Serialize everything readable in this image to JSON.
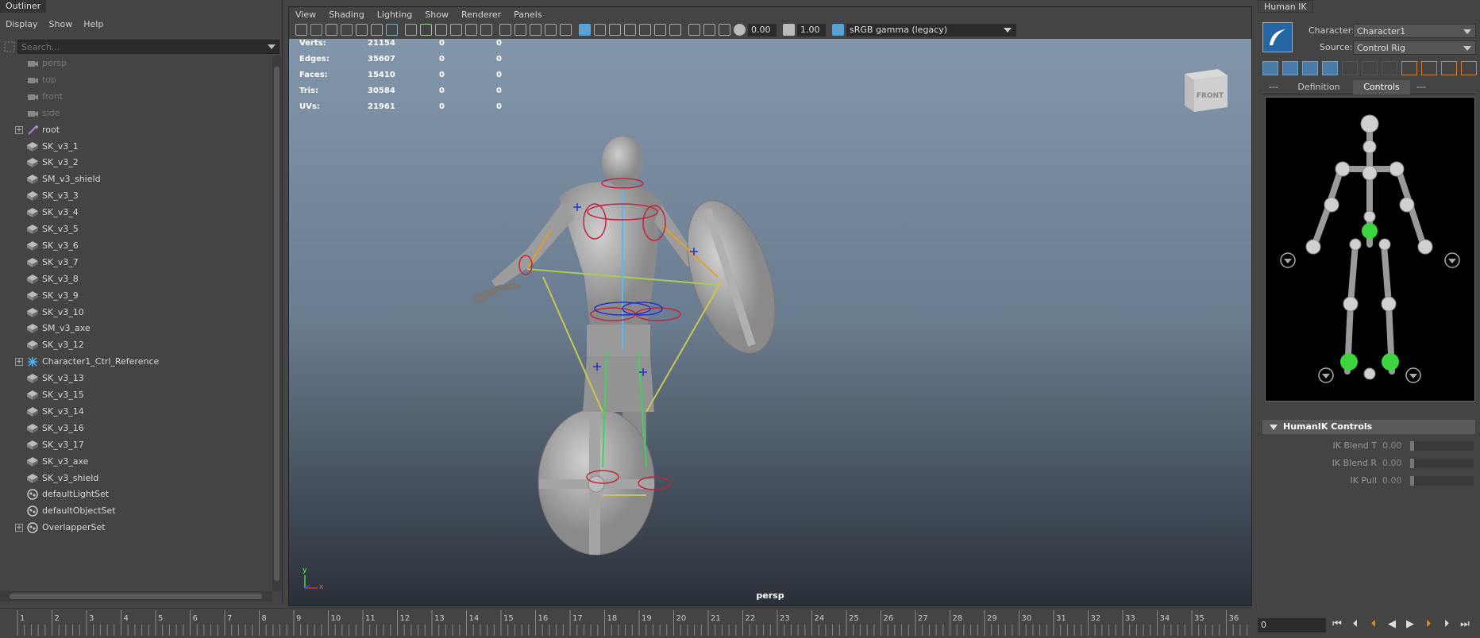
{
  "outliner": {
    "title": "Outliner",
    "menus": [
      "Display",
      "Show",
      "Help"
    ],
    "search_placeholder": "Search...",
    "items": [
      {
        "label": "persp",
        "type": "camera",
        "dim": true,
        "expand": false
      },
      {
        "label": "top",
        "type": "camera",
        "dim": true,
        "expand": false
      },
      {
        "label": "front",
        "type": "camera",
        "dim": true,
        "expand": false
      },
      {
        "label": "side",
        "type": "camera",
        "dim": true,
        "expand": false
      },
      {
        "label": "root",
        "type": "joint",
        "dim": false,
        "expand": true
      },
      {
        "label": "SK_v3_1",
        "type": "mesh",
        "dim": false,
        "expand": false
      },
      {
        "label": "SK_v3_2",
        "type": "mesh",
        "dim": false,
        "expand": false
      },
      {
        "label": "SM_v3_shield",
        "type": "mesh",
        "dim": false,
        "expand": false
      },
      {
        "label": "SK_v3_3",
        "type": "mesh",
        "dim": false,
        "expand": false
      },
      {
        "label": "SK_v3_4",
        "type": "mesh",
        "dim": false,
        "expand": false
      },
      {
        "label": "SK_v3_5",
        "type": "mesh",
        "dim": false,
        "expand": false
      },
      {
        "label": "SK_v3_6",
        "type": "mesh",
        "dim": false,
        "expand": false
      },
      {
        "label": "SK_v3_7",
        "type": "mesh",
        "dim": false,
        "expand": false
      },
      {
        "label": "SK_v3_8",
        "type": "mesh",
        "dim": false,
        "expand": false
      },
      {
        "label": "SK_v3_9",
        "type": "mesh",
        "dim": false,
        "expand": false
      },
      {
        "label": "SK_v3_10",
        "type": "mesh",
        "dim": false,
        "expand": false
      },
      {
        "label": "SM_v3_axe",
        "type": "mesh",
        "dim": false,
        "expand": false
      },
      {
        "label": "SK_v3_12",
        "type": "mesh",
        "dim": false,
        "expand": false
      },
      {
        "label": "Character1_Ctrl_Reference",
        "type": "ctrl",
        "dim": false,
        "expand": true
      },
      {
        "label": "SK_v3_13",
        "type": "mesh",
        "dim": false,
        "expand": false
      },
      {
        "label": "SK_v3_15",
        "type": "mesh",
        "dim": false,
        "expand": false
      },
      {
        "label": "SK_v3_14",
        "type": "mesh",
        "dim": false,
        "expand": false
      },
      {
        "label": "SK_v3_16",
        "type": "mesh",
        "dim": false,
        "expand": false
      },
      {
        "label": "SK_v3_17",
        "type": "mesh",
        "dim": false,
        "expand": false
      },
      {
        "label": "SK_v3_axe",
        "type": "mesh",
        "dim": false,
        "expand": false
      },
      {
        "label": "SK_v3_shield",
        "type": "mesh",
        "dim": false,
        "expand": false
      },
      {
        "label": "defaultLightSet",
        "type": "set",
        "dim": false,
        "expand": false
      },
      {
        "label": "defaultObjectSet",
        "type": "set",
        "dim": false,
        "expand": false
      },
      {
        "label": "OverlapperSet",
        "type": "set",
        "dim": false,
        "expand": true
      }
    ]
  },
  "viewport": {
    "menus": [
      "View",
      "Shading",
      "Lighting",
      "Show",
      "Renderer",
      "Panels"
    ],
    "exposure": "0.00",
    "gamma": "1.00",
    "color_space": "sRGB gamma (legacy)",
    "camera": "persp",
    "viewcube_label": "FRONT",
    "hud": [
      {
        "label": "Verts:",
        "v1": "21154",
        "v2": "0",
        "v3": "0"
      },
      {
        "label": "Edges:",
        "v1": "35607",
        "v2": "0",
        "v3": "0"
      },
      {
        "label": "Faces:",
        "v1": "15410",
        "v2": "0",
        "v3": "0"
      },
      {
        "label": "Tris:",
        "v1": "30584",
        "v2": "0",
        "v3": "0"
      },
      {
        "label": "UVs:",
        "v1": "21961",
        "v2": "0",
        "v3": "0"
      }
    ],
    "axis_y": "y",
    "axis_x": "x"
  },
  "human_ik": {
    "title": "Human IK",
    "character_label": "Character:",
    "character_value": "Character1",
    "source_label": "Source:",
    "source_value": "Control Rig",
    "tabs": [
      "---",
      "Definition",
      "Controls",
      "---"
    ],
    "active_tab": "Controls",
    "controls_header": "HumanIK Controls",
    "ik_rows": [
      {
        "label": "IK Blend T",
        "value": "0.00"
      },
      {
        "label": "IK Blend R",
        "value": "0.00"
      },
      {
        "label": "IK Pull",
        "value": "0.00"
      }
    ]
  },
  "timeline": {
    "ticks": [
      "1",
      "2",
      "3",
      "4",
      "5",
      "6",
      "7",
      "8",
      "9",
      "10",
      "11",
      "12",
      "13",
      "14",
      "15",
      "16",
      "17",
      "18",
      "19",
      "20",
      "21",
      "22",
      "23",
      "24",
      "25",
      "26",
      "27",
      "28",
      "29",
      "30",
      "31",
      "32",
      "33",
      "34",
      "35",
      "36"
    ],
    "current_frame": "0"
  },
  "colors": {
    "accent": "#5285a6",
    "green": "#39c939",
    "panel": "#444444"
  }
}
